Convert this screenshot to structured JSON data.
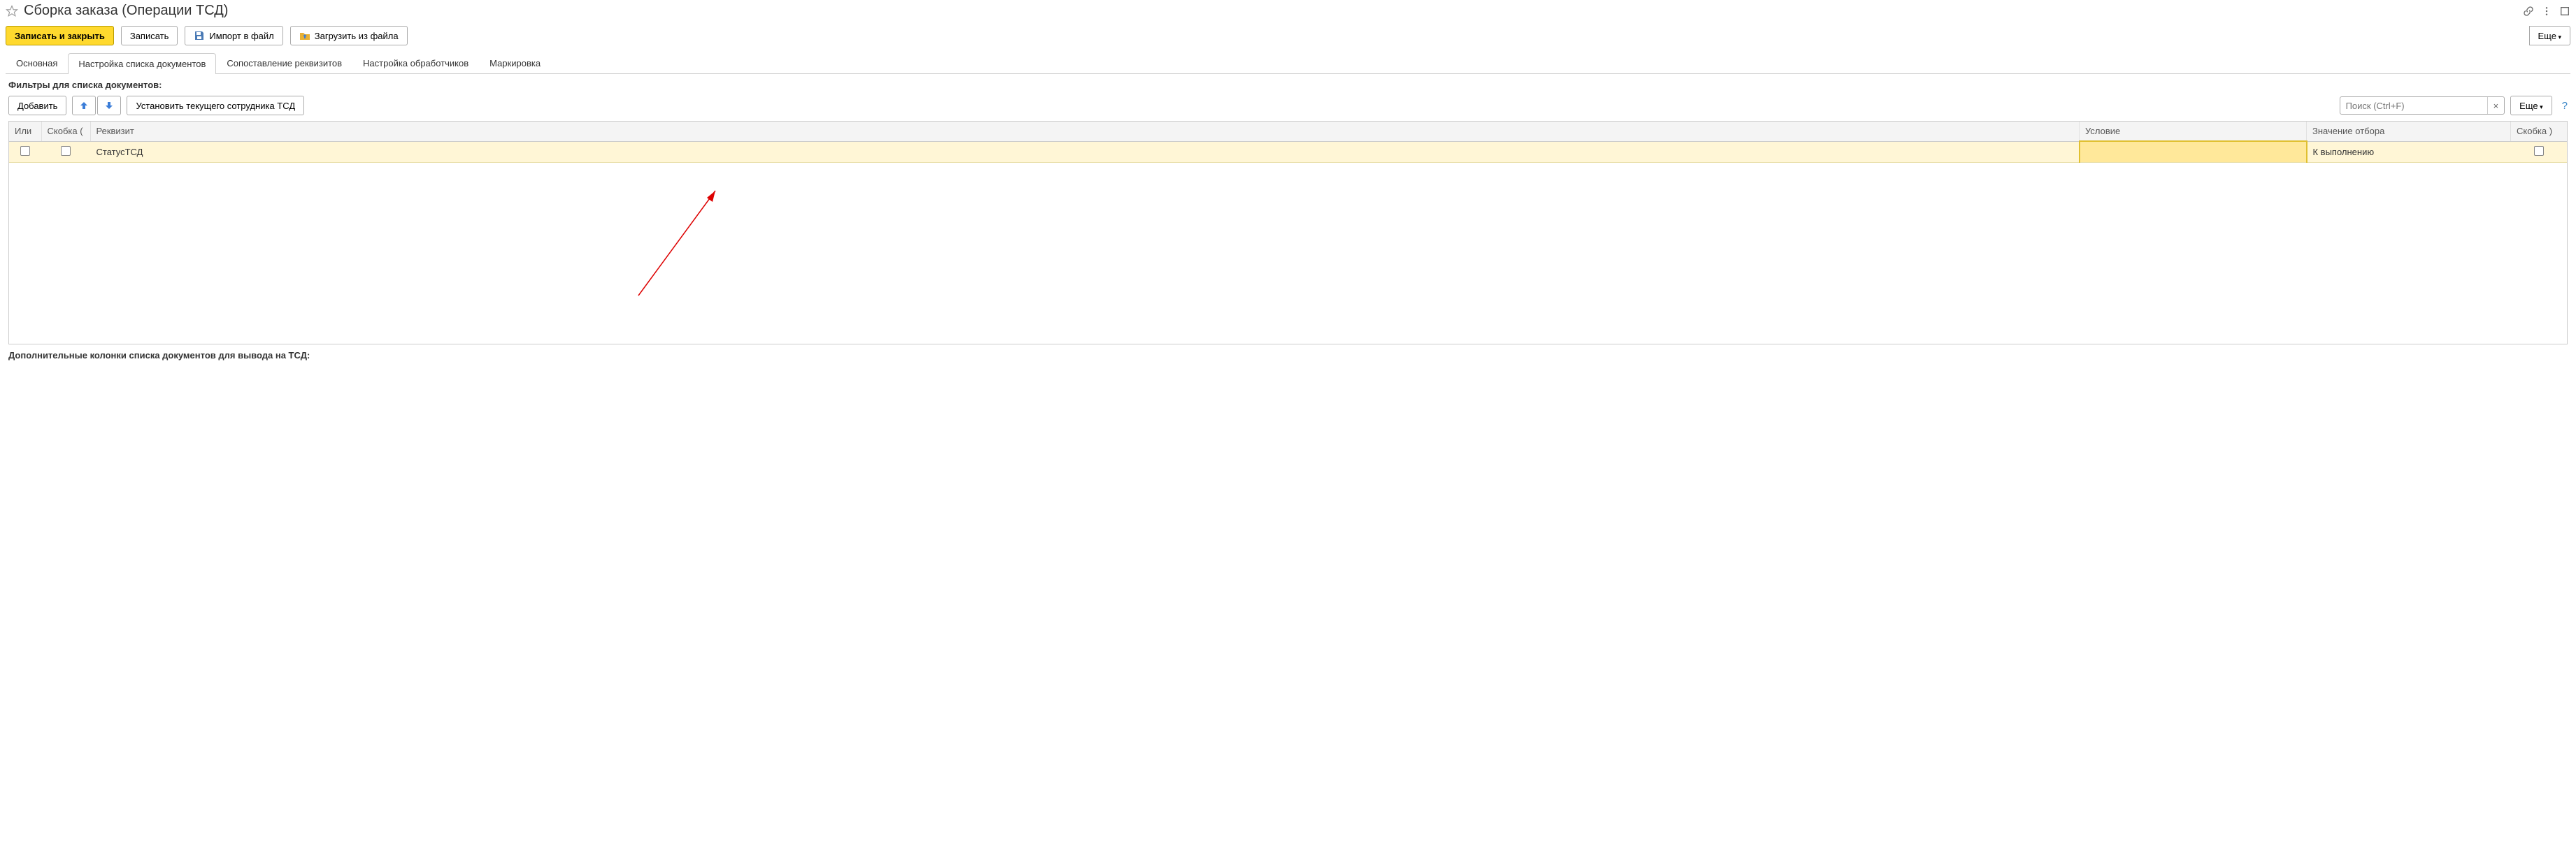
{
  "header": {
    "title": "Сборка заказа (Операции ТСД)"
  },
  "toolbar": {
    "save_close": "Записать и закрыть",
    "save": "Записать",
    "import_file": "Импорт в файл",
    "load_file": "Загрузить из файла",
    "more": "Еще"
  },
  "tabs": [
    {
      "label": "Основная"
    },
    {
      "label": "Настройка списка документов"
    },
    {
      "label": "Сопоставление реквизитов"
    },
    {
      "label": "Настройка обработчиков"
    },
    {
      "label": "Маркировка"
    }
  ],
  "filters_section_title": "Фильтры для списка документов:",
  "filter_toolbar": {
    "add": "Добавить",
    "set_current_tsd_employee": "Установить текущего сотрудника ТСД",
    "search_placeholder": "Поиск (Ctrl+F)",
    "more": "Еще"
  },
  "table": {
    "headers": {
      "or": "Или",
      "bracket_open": "Скобка (",
      "requisite": "Реквизит",
      "condition": "Условие",
      "filter_value": "Значение отбора",
      "bracket_close": "Скобка )"
    },
    "row": {
      "requisite": "СтатусТСД",
      "condition": "",
      "filter_value": "К выполнению"
    }
  },
  "bottom_section_title": "Дополнительные колонки списка документов для вывода на ТСД:"
}
